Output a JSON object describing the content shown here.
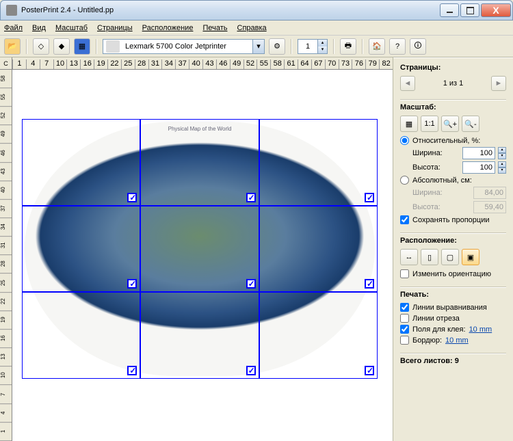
{
  "window": {
    "title": "PosterPrint 2.4 - Untitled.pp"
  },
  "menubar": [
    "Файл",
    "Вид",
    "Масштаб",
    "Страницы",
    "Расположение",
    "Печать",
    "Справка"
  ],
  "toolbar": {
    "printer": "Lexmark 5700 Color Jetprinter",
    "page_spinner": "1"
  },
  "ruler_h": [
    "1",
    "4",
    "7",
    "10",
    "13",
    "16",
    "19",
    "22",
    "25",
    "28",
    "31",
    "34",
    "37",
    "40",
    "43",
    "46",
    "49",
    "52",
    "55",
    "58",
    "61",
    "64",
    "67",
    "70",
    "73",
    "76",
    "79",
    "82"
  ],
  "ruler_v": [
    "1",
    "4",
    "7",
    "10",
    "13",
    "16",
    "19",
    "22",
    "25",
    "28",
    "31",
    "34",
    "37",
    "40",
    "43",
    "46",
    "49",
    "52",
    "55",
    "58"
  ],
  "corner": "C",
  "map_title": "Physical Map of the World",
  "sidebar": {
    "pages": {
      "title": "Страницы:",
      "indicator": "1 из 1"
    },
    "scale": {
      "title": "Масштаб:",
      "relative_label": "Относительный, %:",
      "width_label": "Ширина:",
      "height_label": "Высота:",
      "width_val": "100",
      "height_val": "100",
      "absolute_label": "Абсолютный, см:",
      "abs_width": "84,00",
      "abs_height": "59,40",
      "keep_ratio": "Сохранять пропорции"
    },
    "layout": {
      "title": "Расположение:",
      "change_orientation": "Изменить ориентацию"
    },
    "print": {
      "title": "Печать:",
      "align_lines": "Линии выравнивания",
      "cut_lines": "Линии отреза",
      "glue_margins": "Поля для клея:",
      "glue_val": "10 mm",
      "border": "Бордюр:",
      "border_val": "10 mm"
    },
    "total": {
      "label": "Всего листов:",
      "value": "9"
    }
  }
}
